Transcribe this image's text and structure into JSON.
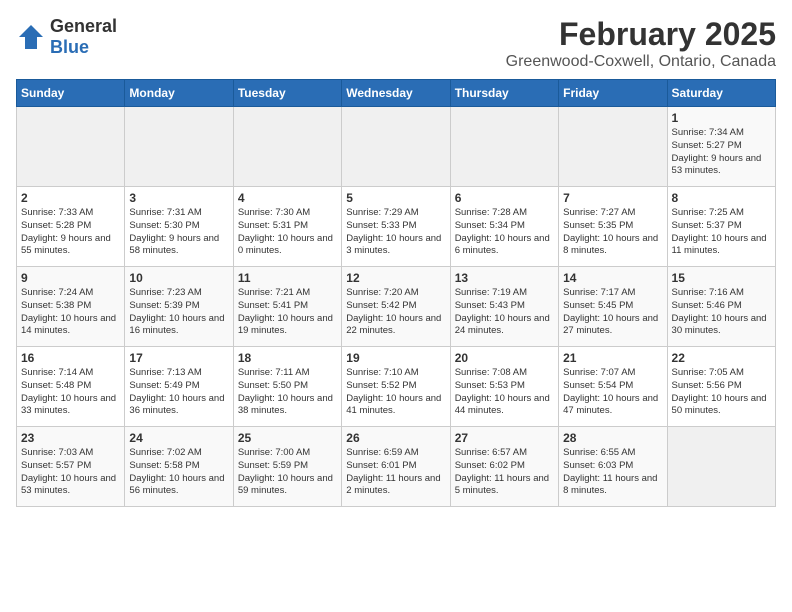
{
  "app": {
    "logo_general": "General",
    "logo_blue": "Blue"
  },
  "header": {
    "month": "February 2025",
    "location": "Greenwood-Coxwell, Ontario, Canada"
  },
  "weekdays": [
    "Sunday",
    "Monday",
    "Tuesday",
    "Wednesday",
    "Thursday",
    "Friday",
    "Saturday"
  ],
  "weeks": [
    [
      {
        "day": "",
        "empty": true
      },
      {
        "day": "",
        "empty": true
      },
      {
        "day": "",
        "empty": true
      },
      {
        "day": "",
        "empty": true
      },
      {
        "day": "",
        "empty": true
      },
      {
        "day": "",
        "empty": true
      },
      {
        "day": "1",
        "info": "Sunrise: 7:34 AM\nSunset: 5:27 PM\nDaylight: 9 hours and 53 minutes."
      }
    ],
    [
      {
        "day": "2",
        "info": "Sunrise: 7:33 AM\nSunset: 5:28 PM\nDaylight: 9 hours and 55 minutes."
      },
      {
        "day": "3",
        "info": "Sunrise: 7:31 AM\nSunset: 5:30 PM\nDaylight: 9 hours and 58 minutes."
      },
      {
        "day": "4",
        "info": "Sunrise: 7:30 AM\nSunset: 5:31 PM\nDaylight: 10 hours and 0 minutes."
      },
      {
        "day": "5",
        "info": "Sunrise: 7:29 AM\nSunset: 5:33 PM\nDaylight: 10 hours and 3 minutes."
      },
      {
        "day": "6",
        "info": "Sunrise: 7:28 AM\nSunset: 5:34 PM\nDaylight: 10 hours and 6 minutes."
      },
      {
        "day": "7",
        "info": "Sunrise: 7:27 AM\nSunset: 5:35 PM\nDaylight: 10 hours and 8 minutes."
      },
      {
        "day": "8",
        "info": "Sunrise: 7:25 AM\nSunset: 5:37 PM\nDaylight: 10 hours and 11 minutes."
      }
    ],
    [
      {
        "day": "9",
        "info": "Sunrise: 7:24 AM\nSunset: 5:38 PM\nDaylight: 10 hours and 14 minutes."
      },
      {
        "day": "10",
        "info": "Sunrise: 7:23 AM\nSunset: 5:39 PM\nDaylight: 10 hours and 16 minutes."
      },
      {
        "day": "11",
        "info": "Sunrise: 7:21 AM\nSunset: 5:41 PM\nDaylight: 10 hours and 19 minutes."
      },
      {
        "day": "12",
        "info": "Sunrise: 7:20 AM\nSunset: 5:42 PM\nDaylight: 10 hours and 22 minutes."
      },
      {
        "day": "13",
        "info": "Sunrise: 7:19 AM\nSunset: 5:43 PM\nDaylight: 10 hours and 24 minutes."
      },
      {
        "day": "14",
        "info": "Sunrise: 7:17 AM\nSunset: 5:45 PM\nDaylight: 10 hours and 27 minutes."
      },
      {
        "day": "15",
        "info": "Sunrise: 7:16 AM\nSunset: 5:46 PM\nDaylight: 10 hours and 30 minutes."
      }
    ],
    [
      {
        "day": "16",
        "info": "Sunrise: 7:14 AM\nSunset: 5:48 PM\nDaylight: 10 hours and 33 minutes."
      },
      {
        "day": "17",
        "info": "Sunrise: 7:13 AM\nSunset: 5:49 PM\nDaylight: 10 hours and 36 minutes."
      },
      {
        "day": "18",
        "info": "Sunrise: 7:11 AM\nSunset: 5:50 PM\nDaylight: 10 hours and 38 minutes."
      },
      {
        "day": "19",
        "info": "Sunrise: 7:10 AM\nSunset: 5:52 PM\nDaylight: 10 hours and 41 minutes."
      },
      {
        "day": "20",
        "info": "Sunrise: 7:08 AM\nSunset: 5:53 PM\nDaylight: 10 hours and 44 minutes."
      },
      {
        "day": "21",
        "info": "Sunrise: 7:07 AM\nSunset: 5:54 PM\nDaylight: 10 hours and 47 minutes."
      },
      {
        "day": "22",
        "info": "Sunrise: 7:05 AM\nSunset: 5:56 PM\nDaylight: 10 hours and 50 minutes."
      }
    ],
    [
      {
        "day": "23",
        "info": "Sunrise: 7:03 AM\nSunset: 5:57 PM\nDaylight: 10 hours and 53 minutes."
      },
      {
        "day": "24",
        "info": "Sunrise: 7:02 AM\nSunset: 5:58 PM\nDaylight: 10 hours and 56 minutes."
      },
      {
        "day": "25",
        "info": "Sunrise: 7:00 AM\nSunset: 5:59 PM\nDaylight: 10 hours and 59 minutes."
      },
      {
        "day": "26",
        "info": "Sunrise: 6:59 AM\nSunset: 6:01 PM\nDaylight: 11 hours and 2 minutes."
      },
      {
        "day": "27",
        "info": "Sunrise: 6:57 AM\nSunset: 6:02 PM\nDaylight: 11 hours and 5 minutes."
      },
      {
        "day": "28",
        "info": "Sunrise: 6:55 AM\nSunset: 6:03 PM\nDaylight: 11 hours and 8 minutes."
      },
      {
        "day": "",
        "empty": true
      }
    ]
  ]
}
